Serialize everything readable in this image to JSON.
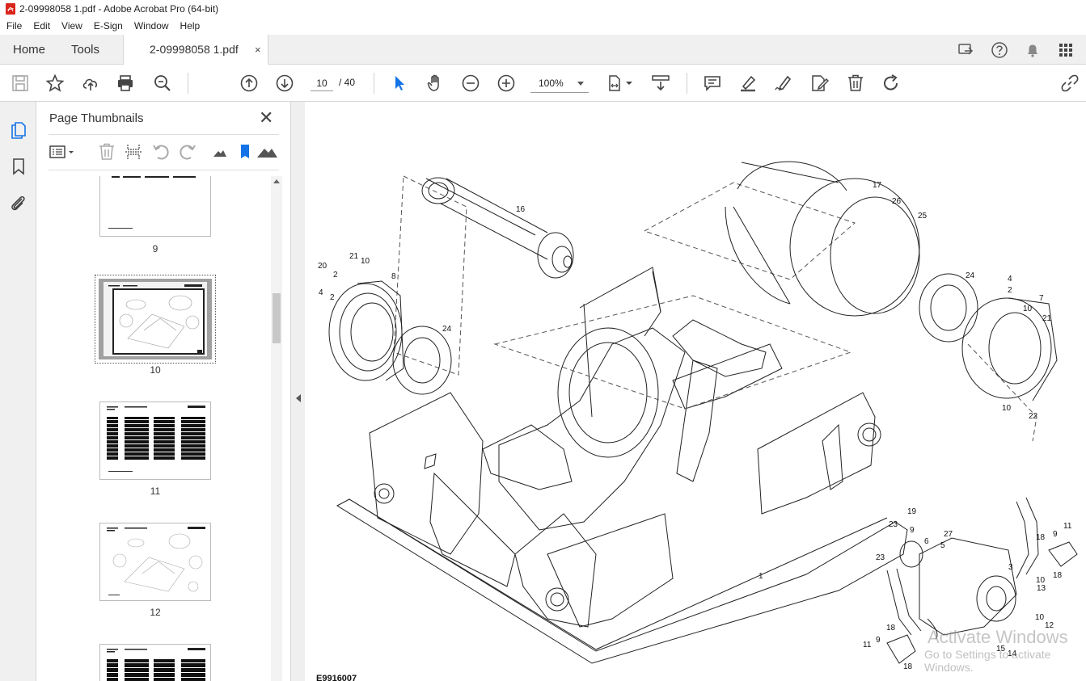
{
  "window": {
    "title": "2-09998058 1.pdf - Adobe Acrobat Pro (64-bit)"
  },
  "menu": [
    "File",
    "Edit",
    "View",
    "E-Sign",
    "Window",
    "Help"
  ],
  "tabs": {
    "home": "Home",
    "tools": "Tools",
    "document": "2-09998058 1.pdf",
    "close_glyph": "×"
  },
  "toolbar": {
    "page_current": "10",
    "page_total": "/ 40",
    "zoom": "100%"
  },
  "panel": {
    "title": "Page Thumbnails",
    "close_glyph": "✕",
    "thumbnails": [
      {
        "label": "9"
      },
      {
        "label": "10",
        "selected": true
      },
      {
        "label": "11"
      },
      {
        "label": "12"
      },
      {
        "label": ""
      }
    ]
  },
  "document": {
    "figure_code": "E9916007",
    "callouts": [
      "1",
      "2",
      "3",
      "4",
      "5",
      "6",
      "7",
      "8",
      "9",
      "10",
      "11",
      "12",
      "13",
      "14",
      "15",
      "16",
      "17",
      "18",
      "19",
      "20",
      "21",
      "22",
      "23",
      "24",
      "25",
      "26",
      "27"
    ],
    "watermark_line1": "Activate Windows",
    "watermark_line2": "Go to Settings to activate Windows."
  },
  "icons": {
    "title": "pdf-icon",
    "top_right": [
      "share-screen-icon",
      "help-icon",
      "bell-icon",
      "apps-grid-icon"
    ],
    "toolbar": [
      "save-icon",
      "star-icon",
      "upload-icon",
      "print-icon",
      "zoom-search-icon",
      "page-up-icon",
      "page-down-icon",
      "select-cursor-icon",
      "hand-icon",
      "zoom-out-icon",
      "zoom-in-icon",
      "fit-page-icon",
      "scroll-mode-icon",
      "comment-icon",
      "highlight-icon",
      "sign-icon",
      "edit-icon",
      "delete-icon",
      "redo-icon",
      "link-icon"
    ],
    "rail": [
      "pages-icon",
      "bookmark-icon",
      "attachment-icon"
    ],
    "panel_tools": [
      "options-menu-icon",
      "delete-page-icon",
      "extract-icon",
      "rotate-ccw-icon",
      "rotate-cw-icon",
      "small-thumbs-icon",
      "bookmark-blue-icon",
      "large-thumbs-icon"
    ]
  },
  "colors": {
    "accent_blue": "#1473e6",
    "pdf_red": "#d9251c"
  }
}
